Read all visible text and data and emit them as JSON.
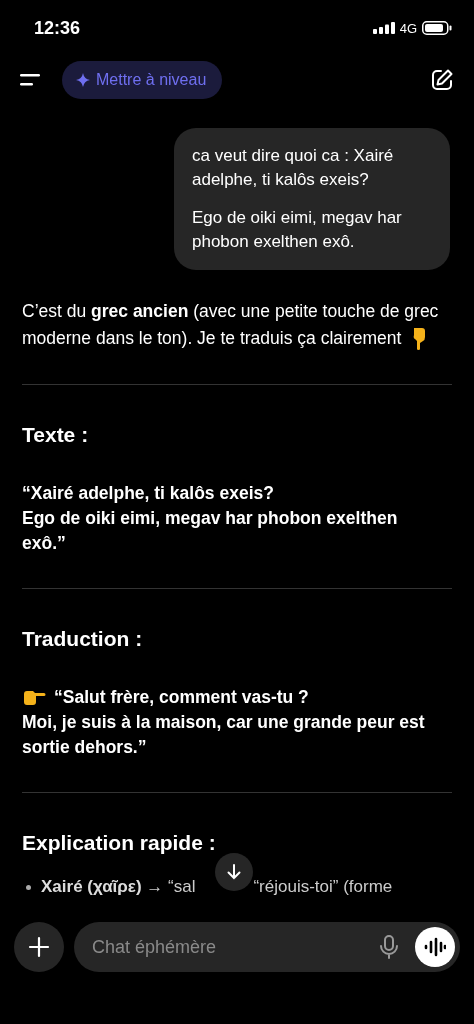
{
  "status_bar": {
    "time": "12:36",
    "network": "4G"
  },
  "top_bar": {
    "upgrade_button": "Mettre à niveau"
  },
  "user_message": {
    "paragraphs": [
      "ca veut dire quoi ca : Xairé adelphe, ti kalôs exeis?",
      "Ego de oiki eimi, megav har phobon exelthen exô."
    ]
  },
  "assistant": {
    "intro": "C’est du **grec ancien** (avec une petite touche de grec moderne dans le ton). Je te traduis ça clairement",
    "sections": [
      {
        "heading": "Texte :",
        "pointer": false,
        "lines": [
          "“Xairé adelphe, ti kalôs exeis?",
          "Ego de oiki eimi, megav har phobon exelthen exô.”"
        ]
      },
      {
        "heading": "Traduction :",
        "pointer": true,
        "lines": [
          "“Salut frère, comment vas-tu ?",
          "Moi, je suis à la maison, car une grande peur est sortie dehors.”"
        ]
      },
      {
        "heading": "Explication rapide :"
      }
    ],
    "bullet": {
      "left": "**Xairé (χαῖρε)** → “sal",
      "right": "“réjouis-toi” (forme"
    }
  },
  "composer": {
    "placeholder": "Chat éphémère"
  }
}
